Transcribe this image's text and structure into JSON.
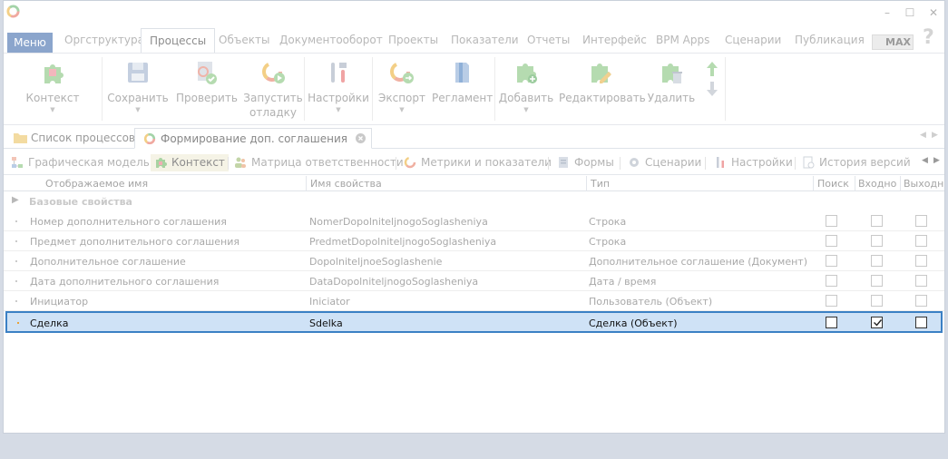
{
  "window": {
    "controls": {
      "minimize": "–",
      "maximize": "☐",
      "close": "✕"
    }
  },
  "menubar": {
    "menu_label": "Меню",
    "tabs": [
      "Оргструктура",
      "Процессы",
      "Объекты",
      "Документооборот",
      "Проекты",
      "Показатели",
      "Отчеты",
      "Интерфейс",
      "BPM Apps",
      "Сценарии",
      "Публикация"
    ],
    "active_tab": "Процессы",
    "badge": "MAX",
    "help": "?"
  },
  "ribbon": {
    "context": "Контекст",
    "save": "Сохранить",
    "check": "Проверить",
    "debug_line1": "Запустить",
    "debug_line2": "отладку",
    "settings": "Настройки",
    "export": "Экспорт",
    "regulation": "Регламент",
    "add": "Добавить",
    "edit": "Редактировать",
    "delete": "Удалить"
  },
  "doctabs": {
    "process_list": "Список процессов",
    "agreement": "Формирование доп. соглашения"
  },
  "subtoolbar": {
    "graphic_model": "Графическая модель",
    "context": "Контекст",
    "responsibility": "Матрица ответственности",
    "metrics": "Метрики и показатели",
    "forms": "Формы",
    "scenarios": "Сценарии",
    "settings": "Настройки",
    "history": "История версий"
  },
  "grid": {
    "headers": {
      "display_name": "Отображаемое имя",
      "property_name": "Имя свойства",
      "type": "Тип",
      "search": "Поиск",
      "input": "Входно",
      "output": "Выходн"
    },
    "group": "Базовые свойства",
    "rows": [
      {
        "display": "Номер дополнительного соглашения",
        "prop": "NomerDopolniteljnogoSoglasheniya",
        "type": "Строка",
        "search": false,
        "input": false,
        "output": false
      },
      {
        "display": "Предмет дополнительного соглашения",
        "prop": "PredmetDopolniteljnogoSoglasheniya",
        "type": "Строка",
        "search": false,
        "input": false,
        "output": false
      },
      {
        "display": "Дополнительное соглашение",
        "prop": "DopolniteljnoeSoglashenie",
        "type": "Дополнительное соглашение (Документ)",
        "search": false,
        "input": false,
        "output": false
      },
      {
        "display": "Дата дополнительного соглашения",
        "prop": "DataDopolniteljnogoSoglasheniya",
        "type": "Дата / время",
        "search": false,
        "input": false,
        "output": false
      },
      {
        "display": "Инициатор",
        "prop": "Iniciator",
        "type": "Пользователь (Объект)",
        "search": false,
        "input": false,
        "output": false
      },
      {
        "display": "Сделка",
        "prop": "Sdelka",
        "type": "Сделка (Объект)",
        "search": false,
        "input": true,
        "output": false,
        "selected": true
      }
    ]
  }
}
